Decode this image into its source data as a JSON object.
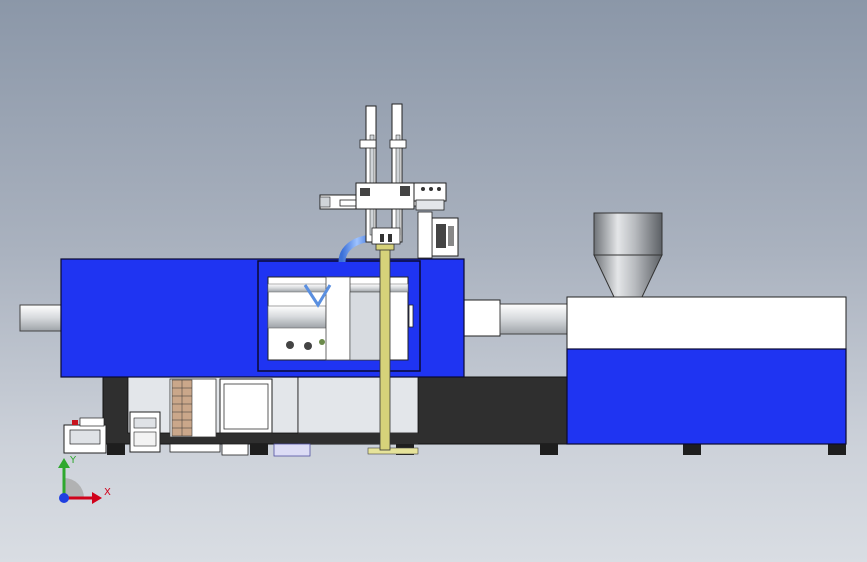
{
  "view": {
    "triad": {
      "x_label": "X",
      "y_label": "Y"
    }
  },
  "colors": {
    "machine_blue": "#1f34f2",
    "base_dark": "#2f2f2f",
    "steel_light": "#e9ecef",
    "axis_x": "#d0021b",
    "axis_y": "#2ea82e",
    "axis_z": "#1f3fe0"
  }
}
